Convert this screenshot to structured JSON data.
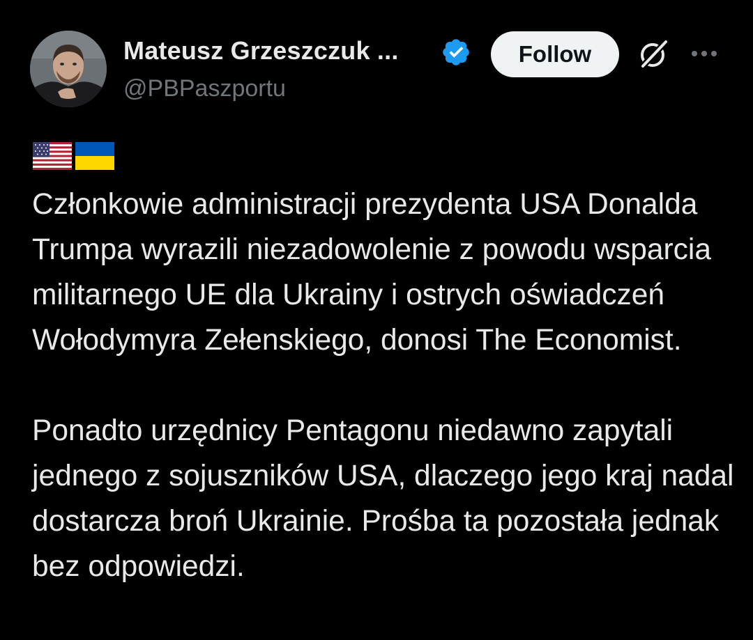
{
  "author": {
    "display_name": "Mateusz Grzeszczuk ...",
    "handle": "@PBPaszportu",
    "verified": true,
    "avatar_icon": "avatar-photo"
  },
  "actions": {
    "follow_label": "Follow",
    "grok_icon": "grok-icon",
    "more_icon": "more-options-icon"
  },
  "tweet": {
    "flags": [
      "us-flag",
      "ukraine-flag"
    ],
    "paragraphs": [
      "Członkowie administracji prezydenta USA Donalda Trumpa wyrazili niezadowolenie z powodu wsparcia militarnego UE dla Ukrainy i ostrych oświadczeń Wołodymyra Zełenskiego, donosi The Economist.",
      "Ponadto urzędnicy Pentagonu niedawno zapytali jednego z sojuszników USA, dlaczego jego kraj nadal dostarcza broń Ukrainie. Prośba ta pozostała jednak bez odpowiedzi."
    ]
  },
  "colors": {
    "background": "#000000",
    "text_primary": "#e7e9ea",
    "text_secondary": "#71767b",
    "verified_blue": "#1d9bf0",
    "follow_bg": "#eff3f4"
  }
}
